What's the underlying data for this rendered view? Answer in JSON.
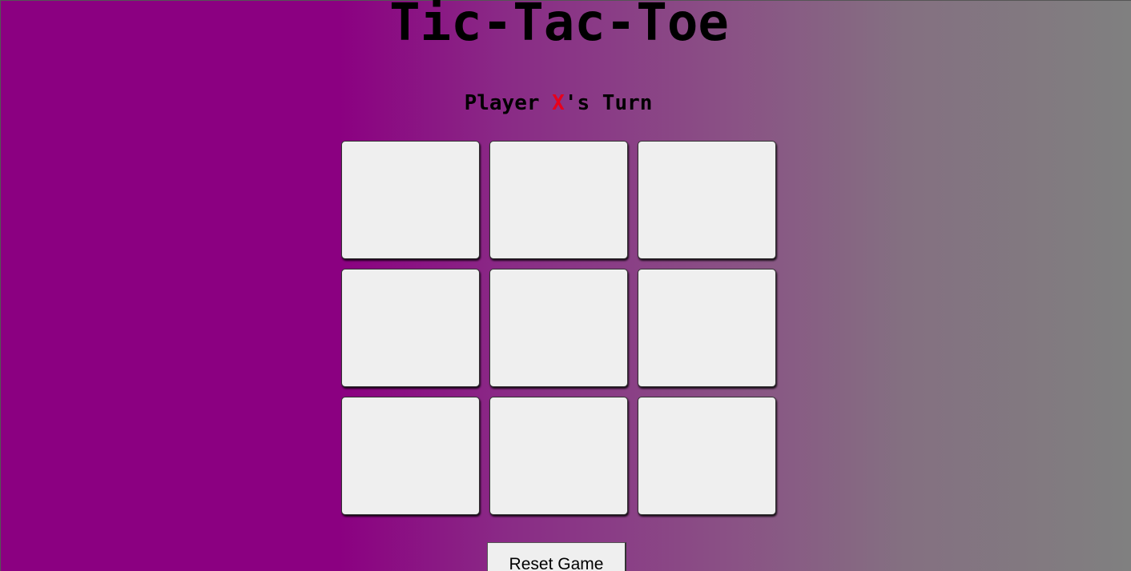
{
  "game": {
    "title": "Tic-Tac-Toe",
    "status": {
      "prefix": "Player ",
      "current_player": "X",
      "suffix": "'s Turn"
    },
    "board": {
      "cells": [
        "",
        "",
        "",
        "",
        "",
        "",
        "",
        "",
        ""
      ]
    },
    "reset_label": "Reset Game"
  },
  "colors": {
    "background_start": "#8b0081",
    "background_end": "#808080",
    "current_player_mark": "#e8001c",
    "cell_background": "#efefef"
  }
}
